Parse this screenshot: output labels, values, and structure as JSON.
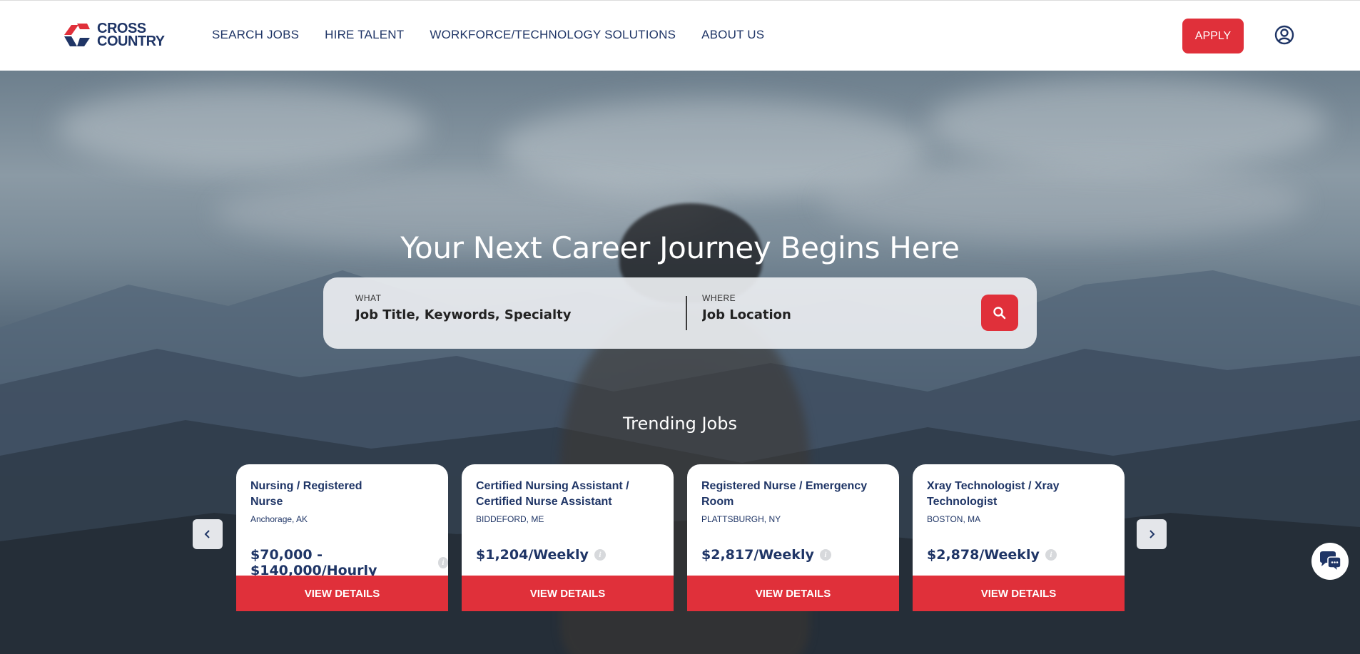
{
  "logo": {
    "line1": "CROSS",
    "line2": "COUNTRY",
    "brand_red": "#e0303a",
    "brand_navy": "#1f3566"
  },
  "nav": {
    "items": [
      {
        "label": "SEARCH JOBS"
      },
      {
        "label": "HIRE TALENT"
      },
      {
        "label": "WORKFORCE/TECHNOLOGY SOLUTIONS"
      },
      {
        "label": "ABOUT US"
      }
    ],
    "apply_label": "APPLY",
    "account_icon": "user-circle-icon"
  },
  "hero": {
    "title": "Your Next Career Journey Begins Here",
    "search": {
      "what_label": "WHAT",
      "what_placeholder": "Job Title, Keywords, Specialty",
      "where_label": "WHERE",
      "where_placeholder": "Job Location",
      "button_icon": "search-icon"
    },
    "trending_title": "Trending Jobs"
  },
  "trending": {
    "cards": [
      {
        "title": "Nursing / Registered Nurse",
        "location": "Anchorage, AK",
        "pay": "$70,000 - $140,000/Hourly",
        "button": "VIEW DETAILS"
      },
      {
        "title": "Certified Nursing Assistant / Certified Nurse Assistant",
        "location": "BIDDEFORD, ME",
        "pay": "$1,204/Weekly",
        "button": "VIEW DETAILS"
      },
      {
        "title": "Registered Nurse / Emergency Room",
        "location": "PLATTSBURGH, NY",
        "pay": "$2,817/Weekly",
        "button": "VIEW DETAILS"
      },
      {
        "title": "Xray Technologist / Xray Technologist",
        "location": "BOSTON, MA",
        "pay": "$2,878/Weekly",
        "button": "VIEW DETAILS"
      }
    ],
    "prev_icon": "chevron-left-icon",
    "next_icon": "chevron-right-icon"
  },
  "chat": {
    "icon": "chat-bubbles-icon"
  }
}
